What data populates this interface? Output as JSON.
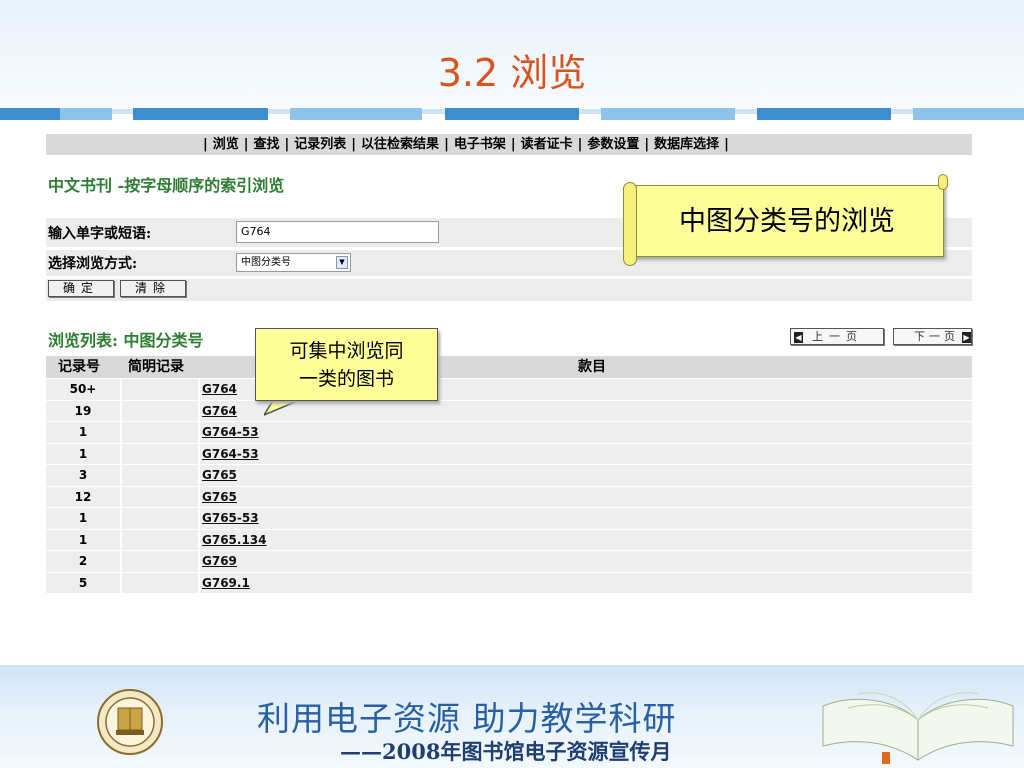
{
  "slide": {
    "title": "3.2 浏览",
    "slogan": "利用电子资源  助力教学科研",
    "subslogan": "——2008年图书馆电子资源宣传月"
  },
  "nav": {
    "items": [
      "浏览",
      "查找",
      "记录列表",
      "以往检索结果",
      "电子书架",
      "读者证卡",
      "参数设置",
      "数据库选择"
    ],
    "separator": "|"
  },
  "search": {
    "section_title": "中文书刊 -按字母顺序的索引浏览",
    "input_label": "输入单字或短语:",
    "input_value": "G764",
    "mode_label": "选择浏览方式:",
    "mode_value": "中图分类号",
    "confirm_label": "确定",
    "clear_label": "清除"
  },
  "browse": {
    "title": "浏览列表: 中图分类号",
    "prev_label": "上一页",
    "next_label": "下一页",
    "columns": [
      "记录号",
      "简明记录",
      "款目"
    ],
    "rows": [
      {
        "count": "50+",
        "entry": "G764"
      },
      {
        "count": "19",
        "entry": "G764"
      },
      {
        "count": "1",
        "entry": "G764-53"
      },
      {
        "count": "1",
        "entry": "G764-53"
      },
      {
        "count": "3",
        "entry": "G765"
      },
      {
        "count": "12",
        "entry": "G765"
      },
      {
        "count": "1",
        "entry": "G765-53"
      },
      {
        "count": "1",
        "entry": "G765.134"
      },
      {
        "count": "2",
        "entry": "G769"
      },
      {
        "count": "5",
        "entry": "G769.1"
      }
    ]
  },
  "callouts": {
    "scroll_note": "中图分类号的浏览",
    "bubble_line1": "可集中浏览同",
    "bubble_line2": "一类的图书"
  },
  "colors": {
    "title": "#d9531e",
    "section": "#2e7d32",
    "slogan": "#2860a6",
    "callout_fill": "#ffff99"
  }
}
